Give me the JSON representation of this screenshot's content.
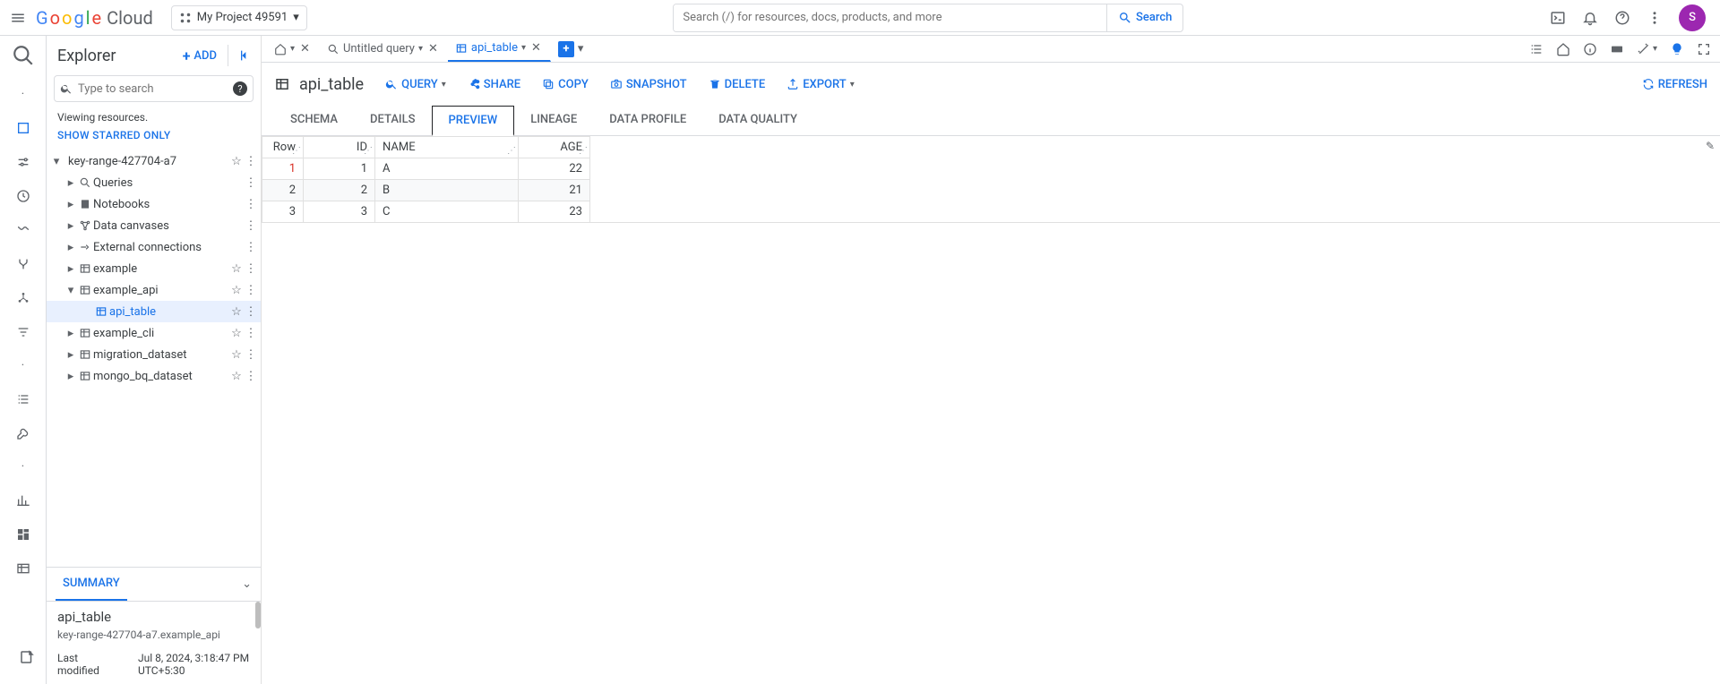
{
  "header": {
    "logo_cloud": "Cloud",
    "project": "My Project 49591",
    "search_placeholder": "Search (/) for resources, docs, products, and more",
    "search_button": "Search",
    "avatar_letter": "S"
  },
  "explorer": {
    "title": "Explorer",
    "add": "ADD",
    "search_placeholder": "Type to search",
    "viewing": "Viewing resources.",
    "show_starred": "SHOW STARRED ONLY",
    "project_node": "key-range-427704-a7",
    "nodes": {
      "queries": "Queries",
      "notebooks": "Notebooks",
      "data_canvases": "Data canvases",
      "external": "External connections",
      "example": "example",
      "example_api": "example_api",
      "api_table": "api_table",
      "example_cli": "example_cli",
      "migration": "migration_dataset",
      "mongo": "mongo_bq_dataset"
    }
  },
  "summary": {
    "tab": "SUMMARY",
    "name": "api_table",
    "path": "key-range-427704-a7.example_api",
    "last_modified_label": "Last modified",
    "last_modified_line1": "Jul 8, 2024, 3:18:47 PM",
    "last_modified_line2": "UTC+5:30"
  },
  "tabs": {
    "untitled": "Untitled query",
    "api_table": "api_table"
  },
  "toolbar": {
    "title": "api_table",
    "query": "QUERY",
    "share": "SHARE",
    "copy": "COPY",
    "snapshot": "SNAPSHOT",
    "delete": "DELETE",
    "export": "EXPORT",
    "refresh": "REFRESH"
  },
  "subtabs": {
    "schema": "SCHEMA",
    "details": "DETAILS",
    "preview": "PREVIEW",
    "lineage": "LINEAGE",
    "data_profile": "DATA PROFILE",
    "data_quality": "DATA QUALITY"
  },
  "grid": {
    "headers": {
      "row": "Row",
      "id": "ID",
      "name": "NAME",
      "age": "AGE"
    },
    "rows": [
      {
        "row": "1",
        "id": "1",
        "name": "A",
        "age": "22"
      },
      {
        "row": "2",
        "id": "2",
        "name": "B",
        "age": "21"
      },
      {
        "row": "3",
        "id": "3",
        "name": "C",
        "age": "23"
      }
    ]
  }
}
